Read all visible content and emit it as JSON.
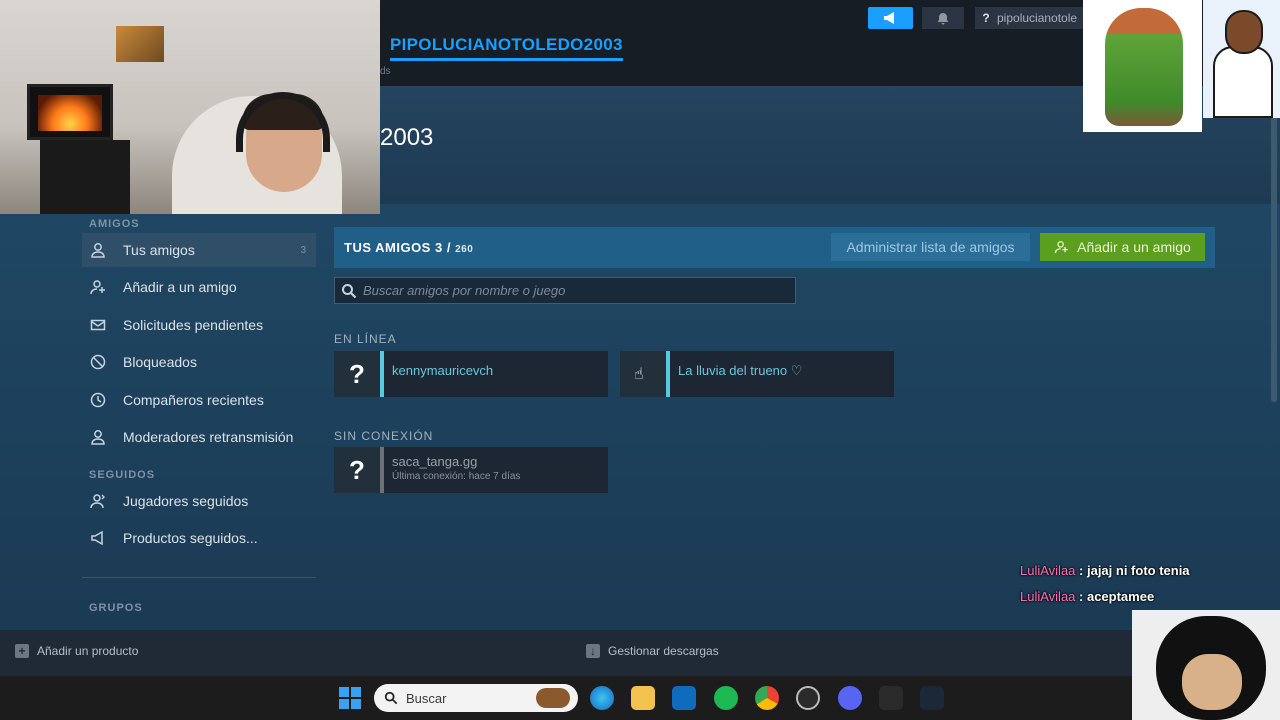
{
  "header": {
    "profile_name": "PIPOLUCIANOTOLEDO2003",
    "subnav_fragment": "ds",
    "account_name": "pipolucianotole",
    "help_glyph": "?"
  },
  "hero": {
    "title_fragment": "2003"
  },
  "sidebar": {
    "friends_section": "AMIGOS",
    "followed_section": "SEGUIDOS",
    "groups_section": "GRUPOS",
    "items": [
      {
        "label": "Tus amigos",
        "count": "3",
        "icon": "person-icon"
      },
      {
        "label": "Añadir a un amigo",
        "icon": "add-person-icon"
      },
      {
        "label": "Solicitudes pendientes",
        "icon": "envelope-icon"
      },
      {
        "label": "Bloqueados",
        "icon": "blocked-icon"
      },
      {
        "label": "Compañeros recientes",
        "icon": "clock-icon"
      },
      {
        "label": "Moderadores retransmisión",
        "icon": "person-icon"
      }
    ],
    "followed_items": [
      {
        "label": "Jugadores seguidos",
        "icon": "follow-person-icon"
      },
      {
        "label": "Productos seguidos...",
        "icon": "megaphone-icon"
      }
    ]
  },
  "friends_panel": {
    "title": "TUS AMIGOS",
    "count": "3",
    "separator": "/",
    "limit": "260",
    "manage_label": "Administrar lista de amigos",
    "add_label": "Añadir a un amigo",
    "search_placeholder": "Buscar amigos por nombre o juego",
    "online_label": "EN LÍNEA",
    "offline_label": "SIN CONEXIÓN",
    "online_friends": [
      {
        "name": "kennymauricevch",
        "avatar": "?"
      },
      {
        "name": "La lluvia del trueno ♡",
        "avatar": ""
      }
    ],
    "offline_friends": [
      {
        "name": "saca_tanga.gg",
        "last_seen": "Última conexión: hace 7 días",
        "avatar": "?"
      }
    ]
  },
  "bottom_bar": {
    "add_product": "Añadir un producto",
    "downloads": "Gestionar descargas"
  },
  "taskbar": {
    "search_label": "Buscar"
  },
  "chat": [
    {
      "user": "LuliAvilaa",
      "message": " : jajaj ni foto tenia"
    },
    {
      "user": "LuliAvilaa",
      "message": " : aceptamee"
    }
  ],
  "colors": {
    "accent_blue": "#1a9fff",
    "online": "#57cbde",
    "add_green": "#5c9e1e",
    "chat_user": "#ff6fb0"
  }
}
